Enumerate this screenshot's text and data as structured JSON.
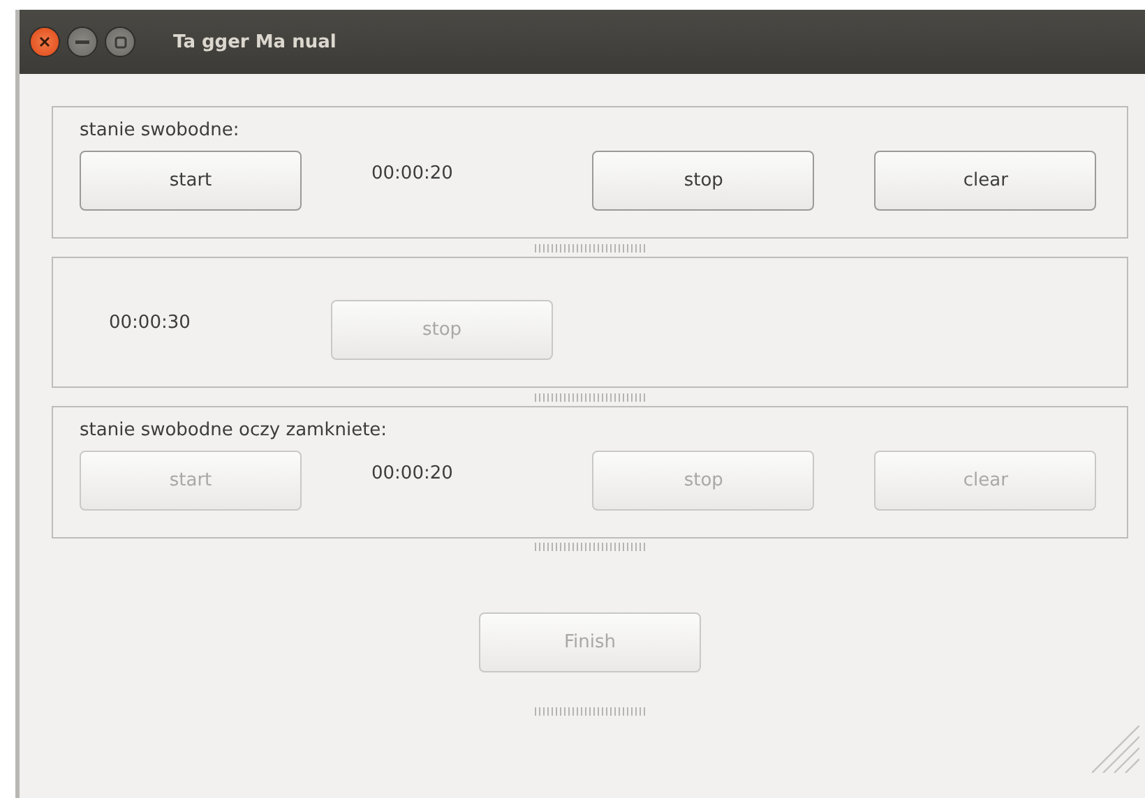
{
  "window": {
    "title": "Ta gger Ma nual"
  },
  "sections": [
    {
      "kind": "labeled",
      "label": "stanie swobodne:",
      "items": [
        {
          "kind": "button",
          "label": "start",
          "disabled": false
        },
        {
          "kind": "time",
          "text": "00:00:20"
        },
        {
          "kind": "button",
          "label": "stop",
          "disabled": false
        },
        {
          "kind": "button",
          "label": "clear",
          "disabled": false
        }
      ]
    },
    {
      "kind": "plain",
      "items": [
        {
          "kind": "time",
          "text": "00:00:30"
        },
        {
          "kind": "button",
          "label": "stop",
          "disabled": true
        }
      ]
    },
    {
      "kind": "labeled",
      "label": "stanie swobodne oczy zamkniete:",
      "items": [
        {
          "kind": "button",
          "label": "start",
          "disabled": true
        },
        {
          "kind": "time",
          "text": "00:00:20"
        },
        {
          "kind": "button",
          "label": "stop",
          "disabled": true
        },
        {
          "kind": "button",
          "label": "clear",
          "disabled": true
        }
      ]
    }
  ],
  "finish": {
    "label": "Finish",
    "disabled": true
  }
}
